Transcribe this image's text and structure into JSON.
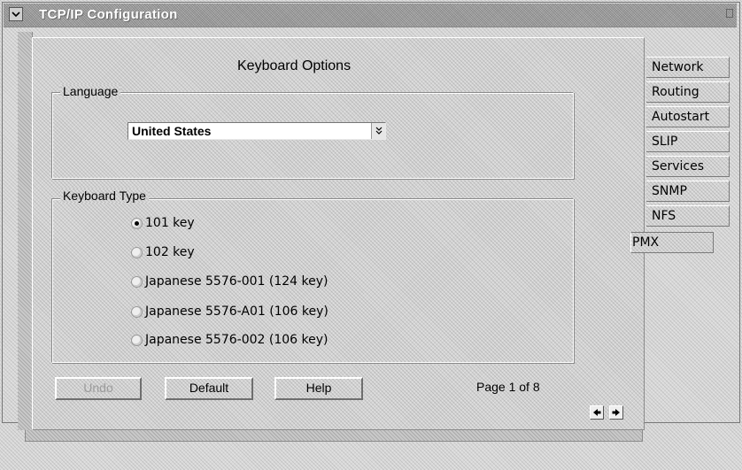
{
  "window": {
    "title": "TCP/IP Configuration"
  },
  "page": {
    "title": "Keyboard Options",
    "indicator": "Page 1 of 8"
  },
  "language_group": {
    "label": "Language",
    "selected_value": "United States"
  },
  "keyboard_group": {
    "label": "Keyboard Type",
    "options": [
      {
        "label": "101 key",
        "checked": true
      },
      {
        "label": "102 key",
        "checked": false
      },
      {
        "label": "Japanese 5576-001 (124 key)",
        "checked": false
      },
      {
        "label": "Japanese 5576-A01 (106 key)",
        "checked": false
      },
      {
        "label": "Japanese 5576-002 (106 key)",
        "checked": false
      }
    ]
  },
  "buttons": {
    "undo": "Undo",
    "default": "Default",
    "help": "Help"
  },
  "tabs": [
    {
      "label": "Network"
    },
    {
      "label": "Routing"
    },
    {
      "label": "Autostart"
    },
    {
      "label": "SLIP"
    },
    {
      "label": "Services"
    },
    {
      "label": "SNMP"
    },
    {
      "label": "NFS"
    },
    {
      "label": "PMX"
    }
  ],
  "icons": {
    "system_menu": "system-menu-icon",
    "dropdown": "chevron-down-icon",
    "prev_page": "arrow-left-icon",
    "next_page": "arrow-right-icon"
  }
}
